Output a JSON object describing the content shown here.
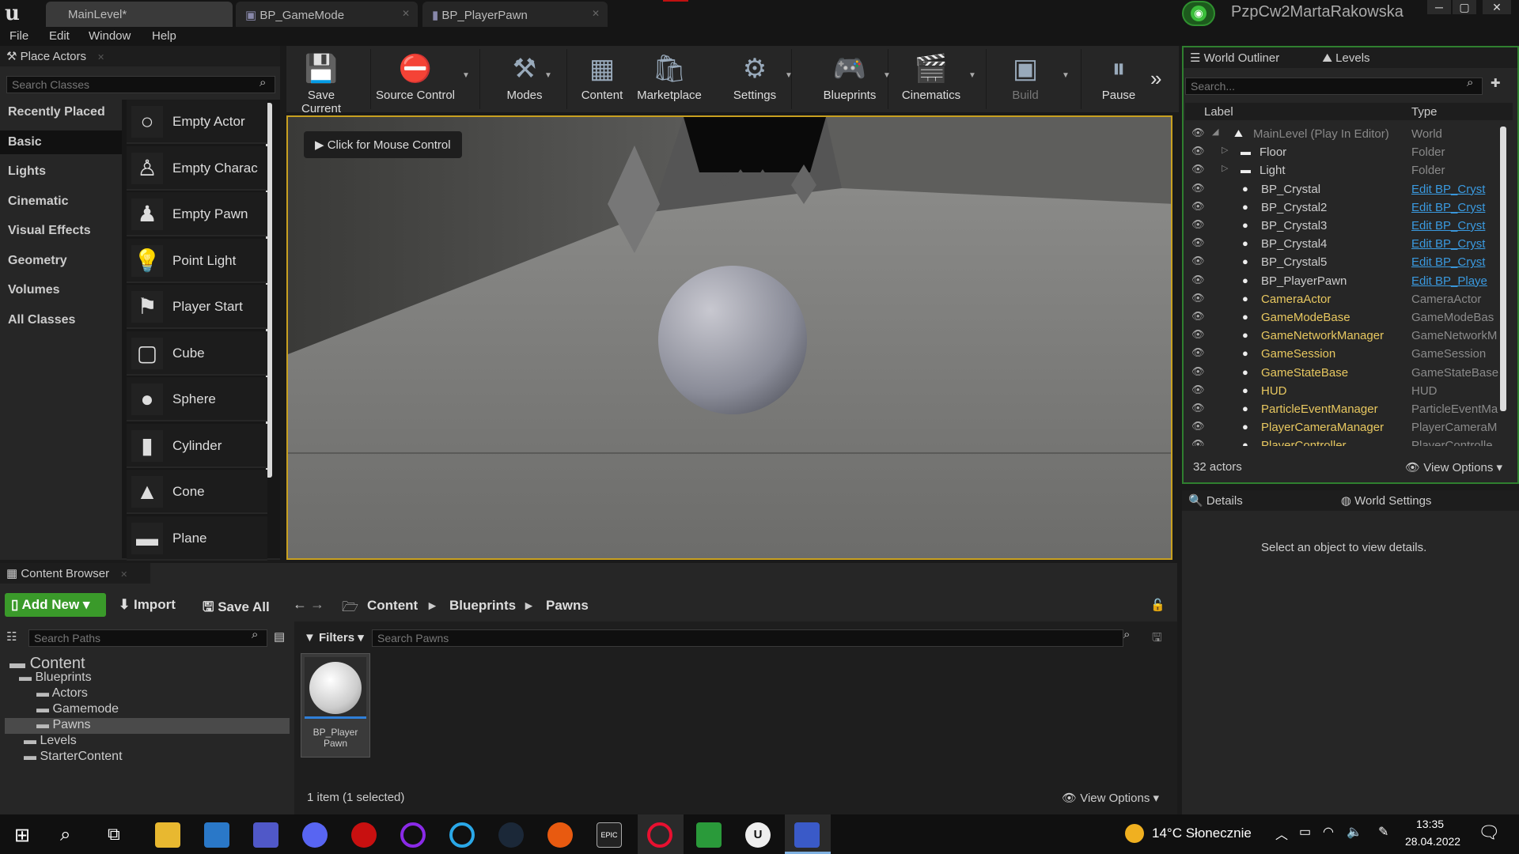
{
  "tabs": [
    {
      "label": "MainLevel*"
    },
    {
      "label": "BP_GameMode"
    },
    {
      "label": "BP_PlayerPawn"
    }
  ],
  "user": {
    "name": "PzpCw2MartaRakowska"
  },
  "window_controls": [
    "─",
    "▢",
    "✕"
  ],
  "menu": [
    "File",
    "Edit",
    "Window",
    "Help"
  ],
  "place_actors": {
    "title": "Place Actors",
    "search_placeholder": "Search Classes",
    "categories": [
      "Recently Placed",
      "Basic",
      "Lights",
      "Cinematic",
      "Visual Effects",
      "Geometry",
      "Volumes",
      "All Classes"
    ],
    "selected_category": "Basic",
    "actors": [
      "Empty Actor",
      "Empty Charac",
      "Empty Pawn",
      "Point Light",
      "Player Start",
      "Cube",
      "Sphere",
      "Cylinder",
      "Cone",
      "Plane"
    ]
  },
  "toolbar": {
    "buttons": [
      "Save Current",
      "Source Control",
      "Modes",
      "Content",
      "Marketplace",
      "Settings",
      "Blueprints",
      "Cinematics",
      "Build",
      "Pause"
    ],
    "more": "»"
  },
  "viewport": {
    "mouse_control": "Click for Mouse Control"
  },
  "outliner": {
    "tabs": [
      "World Outliner",
      "Levels"
    ],
    "search_placeholder": "Search...",
    "col_label": "Label",
    "col_type": "Type",
    "rows": [
      {
        "label": "MainLevel (Play In Editor)",
        "type": "World"
      },
      {
        "label": "Floor",
        "type": "Folder"
      },
      {
        "label": "Light",
        "type": "Folder"
      },
      {
        "label": "BP_Crystal",
        "type": "Edit BP_Cryst"
      },
      {
        "label": "BP_Crystal2",
        "type": "Edit BP_Cryst"
      },
      {
        "label": "BP_Crystal3",
        "type": "Edit BP_Cryst"
      },
      {
        "label": "BP_Crystal4",
        "type": "Edit BP_Cryst"
      },
      {
        "label": "BP_Crystal5",
        "type": "Edit BP_Cryst"
      },
      {
        "label": "BP_PlayerPawn",
        "type": "Edit BP_Playe"
      },
      {
        "label": "CameraActor",
        "type": "CameraActor"
      },
      {
        "label": "GameModeBase",
        "type": "GameModeBas"
      },
      {
        "label": "GameNetworkManager",
        "type": "GameNetworkM"
      },
      {
        "label": "GameSession",
        "type": "GameSession"
      },
      {
        "label": "GameStateBase",
        "type": "GameStateBase"
      },
      {
        "label": "HUD",
        "type": "HUD"
      },
      {
        "label": "ParticleEventManager",
        "type": "ParticleEventMa"
      },
      {
        "label": "PlayerCameraManager",
        "type": "PlayerCameraM"
      },
      {
        "label": "PlayerController",
        "type": "PlayerControlle"
      }
    ],
    "actor_count": "32 actors",
    "view_options": "View Options"
  },
  "details": {
    "tabs": [
      "Details",
      "World Settings"
    ],
    "empty_text": "Select an object to view details."
  },
  "content_browser": {
    "title": "Content Browser",
    "add_new": "Add New",
    "import": "Import",
    "save_all": "Save All",
    "breadcrumb": [
      "Content",
      "Blueprints",
      "Pawns"
    ],
    "search_paths_placeholder": "Search Paths",
    "filters": "Filters",
    "search_placeholder": "Search Pawns",
    "tree": [
      "Content",
      "Blueprints",
      "Actors",
      "Gamemode",
      "Pawns",
      "Levels",
      "StarterContent"
    ],
    "asset": {
      "name": "BP_Player\nPawn"
    },
    "status": "1 item (1 selected)",
    "view_options": "View Options"
  },
  "taskbar": {
    "weather": "14°C  Słonecznie",
    "time": "13:35",
    "date": "28.04.2022"
  }
}
